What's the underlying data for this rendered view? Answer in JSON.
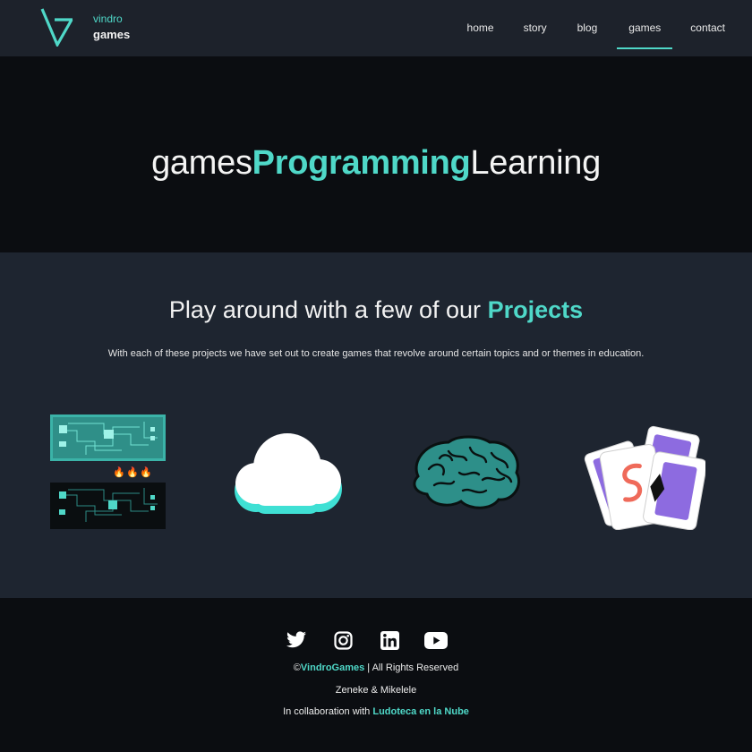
{
  "brand": {
    "line1": "vindro",
    "line2": "games",
    "accent": "#4fd8c8"
  },
  "nav": [
    {
      "label": "home"
    },
    {
      "label": "story"
    },
    {
      "label": "blog"
    },
    {
      "label": "games",
      "active": true
    },
    {
      "label": "contact"
    }
  ],
  "hero": {
    "part1": "games",
    "part2": "Programming",
    "part3": "Learning"
  },
  "projects": {
    "heading_start": "Play around with a few of our ",
    "heading_accent": "Projects",
    "description": "With each of these projects we have set out to create games that revolve around certain topics and or themes in education.",
    "games": [
      {
        "icon": "circuit-board-icon"
      },
      {
        "icon": "cloud-icon"
      },
      {
        "icon": "brain-icon"
      },
      {
        "icon": "playing-cards-icon"
      }
    ]
  },
  "footer": {
    "social": [
      "twitter-icon",
      "instagram-icon",
      "linkedin-icon",
      "youtube-icon"
    ],
    "copyright_symbol": "©",
    "copyright_brand": "VindroGames",
    "copyright_rest": " | All Rights Reserved",
    "authors": "Zeneke & Mikelele",
    "collab_prefix": "In collaboration with ",
    "collab_link": "Ludoteca en la Nube"
  },
  "colors": {
    "header_bg": "#1d222b",
    "section_bg": "#1e2530",
    "dark_bg": "#0b0d11",
    "accent": "#4fd8c8"
  }
}
